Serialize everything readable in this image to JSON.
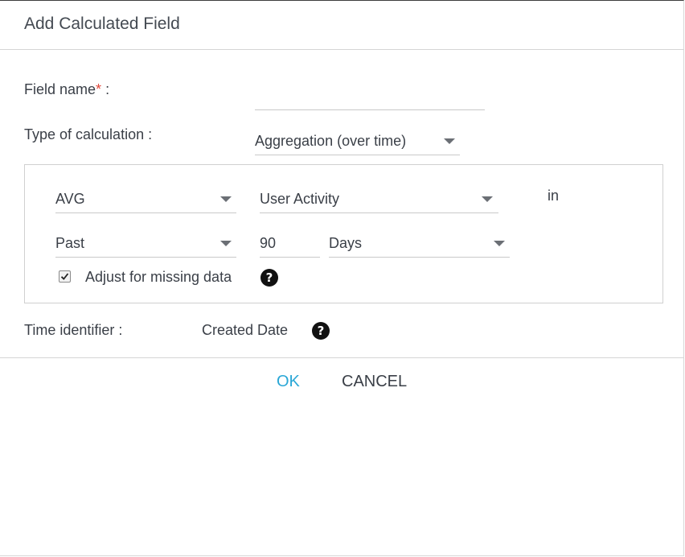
{
  "dialog": {
    "title": "Add Calculated Field"
  },
  "form": {
    "field_name_label": "Field name",
    "required_mark": "*",
    "field_name_colon": " :",
    "field_name_value": "",
    "type_label": "Type of calculation :",
    "type_value": "Aggregation (over time)",
    "function_value": "AVG",
    "metric_value": "User Activity",
    "in_text": "in",
    "period_value": "Past",
    "count_value": "90",
    "unit_value": "Days",
    "adjust_checked": true,
    "adjust_label": "Adjust for missing data",
    "help_glyph": "?",
    "time_identifier_label": "Time identifier :",
    "time_identifier_value": "Created Date"
  },
  "actions": {
    "ok_label": "OK",
    "cancel_label": "CANCEL"
  },
  "colors": {
    "accent": "#2aa7d6",
    "required": "#e0463a",
    "text": "#3a3f47",
    "border": "#d0d0d0"
  },
  "icons": [
    "chevron-down-icon",
    "help-icon",
    "checkmark-icon"
  ]
}
